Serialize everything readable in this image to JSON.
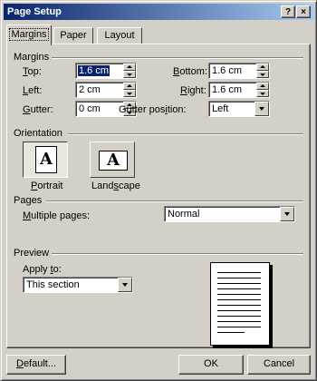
{
  "window": {
    "title": "Page Setup",
    "help_glyph": "?",
    "close_glyph": "×"
  },
  "tabs": [
    {
      "label": "Margins",
      "active": true
    },
    {
      "label": "Paper",
      "active": false
    },
    {
      "label": "Layout",
      "active": false
    }
  ],
  "margins": {
    "section_title": "Margins",
    "top": {
      "label_u": "T",
      "label_rest": "op:",
      "value": "1.6 cm"
    },
    "left": {
      "label_u": "L",
      "label_rest": "eft:",
      "value": "2 cm"
    },
    "gutter": {
      "label_u": "G",
      "label_rest": "utter:",
      "value": "0 cm"
    },
    "bottom": {
      "label_u": "B",
      "label_rest": "ottom:",
      "value": "1.6 cm"
    },
    "right": {
      "label_u": "R",
      "label_rest": "ight:",
      "value": "1.6 cm"
    },
    "gutter_position": {
      "label_pre": "Gutter pos",
      "label_u": "i",
      "label_rest": "tion:",
      "value": "Left"
    }
  },
  "orientation": {
    "section_title": "Orientation",
    "portrait": {
      "label_u": "P",
      "label_rest": "ortrait",
      "glyph": "A",
      "selected": true
    },
    "landscape": {
      "label_pre": "Land",
      "label_u": "s",
      "label_rest": "cape",
      "glyph": "A",
      "selected": false
    }
  },
  "pages": {
    "section_title": "Pages",
    "multiple_pages": {
      "label_u": "M",
      "label_rest": "ultiple pages:",
      "value": "Normal"
    }
  },
  "preview": {
    "section_title": "Preview",
    "apply_to": {
      "label_pre": "Apply ",
      "label_u": "t",
      "label_rest": "o:",
      "value": "This section"
    }
  },
  "buttons": {
    "default": {
      "label_u": "D",
      "label_rest": "efault..."
    },
    "ok": "OK",
    "cancel": "Cancel"
  }
}
